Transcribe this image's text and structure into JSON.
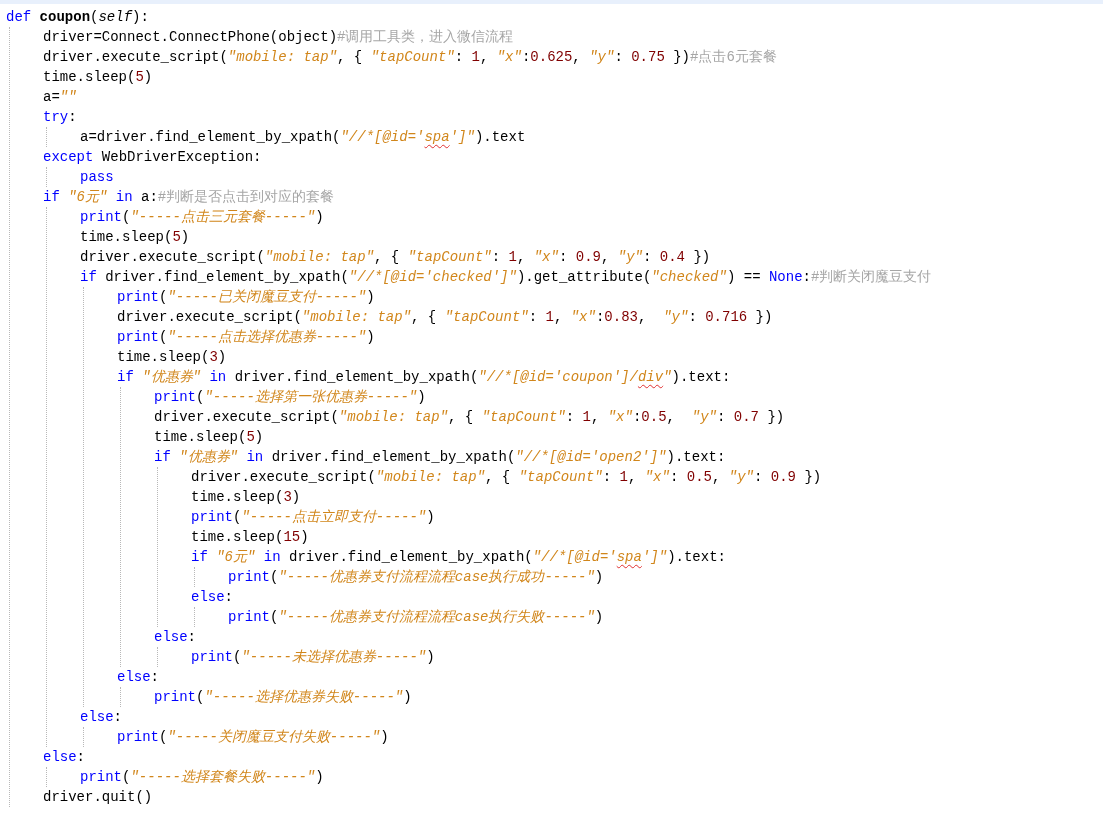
{
  "editor": {
    "lines": [
      {
        "tokens": [
          {
            "kind": "keyword",
            "text": "def"
          },
          {
            "kind": "name",
            "text": " coupon"
          },
          {
            "kind": "plain",
            "text": "("
          },
          {
            "kind": "param",
            "text": "self"
          },
          {
            "kind": "plain",
            "text": "):"
          }
        ],
        "children": [
          {
            "tokens": [
              {
                "kind": "plain",
                "text": "driver=Connect.ConnectPhone(object)"
              },
              {
                "kind": "comment",
                "text": "#调用工具类，进入微信流程"
              }
            ]
          },
          {
            "tokens": [
              {
                "kind": "plain",
                "text": "driver.execute_script("
              },
              {
                "kind": "string",
                "text": "\"mobile: tap\""
              },
              {
                "kind": "plain",
                "text": ", { "
              },
              {
                "kind": "string",
                "text": "\"tapCount\""
              },
              {
                "kind": "plain",
                "text": ": "
              },
              {
                "kind": "number",
                "text": "1"
              },
              {
                "kind": "plain",
                "text": ", "
              },
              {
                "kind": "string",
                "text": "\"x\""
              },
              {
                "kind": "plain",
                "text": ":"
              },
              {
                "kind": "number",
                "text": "0.625"
              },
              {
                "kind": "plain",
                "text": ", "
              },
              {
                "kind": "string",
                "text": "\"y\""
              },
              {
                "kind": "plain",
                "text": ": "
              },
              {
                "kind": "number",
                "text": "0.75"
              },
              {
                "kind": "plain",
                "text": " })"
              },
              {
                "kind": "comment",
                "text": "#点击6元套餐"
              }
            ]
          },
          {
            "tokens": [
              {
                "kind": "plain",
                "text": "time.sleep("
              },
              {
                "kind": "number",
                "text": "5"
              },
              {
                "kind": "plain",
                "text": ")"
              }
            ]
          },
          {
            "tokens": [
              {
                "kind": "plain",
                "text": "a="
              },
              {
                "kind": "string",
                "text": "\"\""
              }
            ]
          },
          {
            "tokens": [
              {
                "kind": "keyword",
                "text": "try"
              },
              {
                "kind": "plain",
                "text": ":"
              }
            ],
            "children": [
              {
                "tokens": [
                  {
                    "kind": "plain",
                    "text": "a=driver.find_element_by_xpath("
                  },
                  {
                    "kind": "string",
                    "text": "\"//*[@id='"
                  },
                  {
                    "kind": "flagged",
                    "text": "spa"
                  },
                  {
                    "kind": "string",
                    "text": "']\""
                  },
                  {
                    "kind": "plain",
                    "text": ").text"
                  }
                ]
              }
            ]
          },
          {
            "tokens": [
              {
                "kind": "keyword",
                "text": "except"
              },
              {
                "kind": "plain",
                "text": " WebDriverException:"
              }
            ],
            "children": [
              {
                "tokens": [
                  {
                    "kind": "keyword",
                    "text": "pass"
                  }
                ]
              }
            ]
          },
          {
            "tokens": [
              {
                "kind": "keyword",
                "text": "if"
              },
              {
                "kind": "string",
                "text": " \"6元\""
              },
              {
                "kind": "keyword",
                "text": " in"
              },
              {
                "kind": "plain",
                "text": " a:"
              },
              {
                "kind": "comment",
                "text": "#判断是否点击到对应的套餐"
              }
            ],
            "children": [
              {
                "tokens": [
                  {
                    "kind": "keyword",
                    "text": "print"
                  },
                  {
                    "kind": "plain",
                    "text": "("
                  },
                  {
                    "kind": "string",
                    "text": "\"-----点击三元套餐-----\""
                  },
                  {
                    "kind": "plain",
                    "text": ")"
                  }
                ]
              },
              {
                "tokens": [
                  {
                    "kind": "plain",
                    "text": "time.sleep("
                  },
                  {
                    "kind": "number",
                    "text": "5"
                  },
                  {
                    "kind": "plain",
                    "text": ")"
                  }
                ]
              },
              {
                "tokens": [
                  {
                    "kind": "plain",
                    "text": "driver.execute_script("
                  },
                  {
                    "kind": "string",
                    "text": "\"mobile: tap\""
                  },
                  {
                    "kind": "plain",
                    "text": ", { "
                  },
                  {
                    "kind": "string",
                    "text": "\"tapCount\""
                  },
                  {
                    "kind": "plain",
                    "text": ": "
                  },
                  {
                    "kind": "number",
                    "text": "1"
                  },
                  {
                    "kind": "plain",
                    "text": ", "
                  },
                  {
                    "kind": "string",
                    "text": "\"x\""
                  },
                  {
                    "kind": "plain",
                    "text": ": "
                  },
                  {
                    "kind": "number",
                    "text": "0.9"
                  },
                  {
                    "kind": "plain",
                    "text": ", "
                  },
                  {
                    "kind": "string",
                    "text": "\"y\""
                  },
                  {
                    "kind": "plain",
                    "text": ": "
                  },
                  {
                    "kind": "number",
                    "text": "0.4"
                  },
                  {
                    "kind": "plain",
                    "text": " })"
                  }
                ]
              },
              {
                "tokens": [
                  {
                    "kind": "keyword",
                    "text": "if"
                  },
                  {
                    "kind": "plain",
                    "text": " driver.find_element_by_xpath("
                  },
                  {
                    "kind": "string",
                    "text": "\"//*[@id='checked']\""
                  },
                  {
                    "kind": "plain",
                    "text": ").get_attribute("
                  },
                  {
                    "kind": "string",
                    "text": "\"checked\""
                  },
                  {
                    "kind": "plain",
                    "text": ") == "
                  },
                  {
                    "kind": "keyword",
                    "text": "None"
                  },
                  {
                    "kind": "plain",
                    "text": ":"
                  },
                  {
                    "kind": "comment",
                    "text": "#判断关闭魔豆支付"
                  }
                ],
                "children": [
                  {
                    "tokens": [
                      {
                        "kind": "keyword",
                        "text": "print"
                      },
                      {
                        "kind": "plain",
                        "text": "("
                      },
                      {
                        "kind": "string",
                        "text": "\"-----已关闭魔豆支付-----\""
                      },
                      {
                        "kind": "plain",
                        "text": ")"
                      }
                    ]
                  },
                  {
                    "tokens": [
                      {
                        "kind": "plain",
                        "text": "driver.execute_script("
                      },
                      {
                        "kind": "string",
                        "text": "\"mobile: tap\""
                      },
                      {
                        "kind": "plain",
                        "text": ", { "
                      },
                      {
                        "kind": "string",
                        "text": "\"tapCount\""
                      },
                      {
                        "kind": "plain",
                        "text": ": "
                      },
                      {
                        "kind": "number",
                        "text": "1"
                      },
                      {
                        "kind": "plain",
                        "text": ", "
                      },
                      {
                        "kind": "string",
                        "text": "\"x\""
                      },
                      {
                        "kind": "plain",
                        "text": ":"
                      },
                      {
                        "kind": "number",
                        "text": "0.83"
                      },
                      {
                        "kind": "plain",
                        "text": ",  "
                      },
                      {
                        "kind": "string",
                        "text": "\"y\""
                      },
                      {
                        "kind": "plain",
                        "text": ": "
                      },
                      {
                        "kind": "number",
                        "text": "0.716"
                      },
                      {
                        "kind": "plain",
                        "text": " })"
                      }
                    ]
                  },
                  {
                    "tokens": [
                      {
                        "kind": "keyword",
                        "text": "print"
                      },
                      {
                        "kind": "plain",
                        "text": "("
                      },
                      {
                        "kind": "string",
                        "text": "\"-----点击选择优惠券-----\""
                      },
                      {
                        "kind": "plain",
                        "text": ")"
                      }
                    ]
                  },
                  {
                    "tokens": [
                      {
                        "kind": "plain",
                        "text": "time.sleep("
                      },
                      {
                        "kind": "number",
                        "text": "3"
                      },
                      {
                        "kind": "plain",
                        "text": ")"
                      }
                    ]
                  },
                  {
                    "tokens": [
                      {
                        "kind": "keyword",
                        "text": "if"
                      },
                      {
                        "kind": "string",
                        "text": " \"优惠券\""
                      },
                      {
                        "kind": "keyword",
                        "text": " in"
                      },
                      {
                        "kind": "plain",
                        "text": " driver.find_element_by_xpath("
                      },
                      {
                        "kind": "string",
                        "text": "\"//*[@id='coupon']/"
                      },
                      {
                        "kind": "flagged",
                        "text": "div"
                      },
                      {
                        "kind": "string",
                        "text": "\""
                      },
                      {
                        "kind": "plain",
                        "text": ").text:"
                      }
                    ],
                    "children": [
                      {
                        "tokens": [
                          {
                            "kind": "keyword",
                            "text": "print"
                          },
                          {
                            "kind": "plain",
                            "text": "("
                          },
                          {
                            "kind": "string",
                            "text": "\"-----选择第一张优惠券-----\""
                          },
                          {
                            "kind": "plain",
                            "text": ")"
                          }
                        ]
                      },
                      {
                        "tokens": [
                          {
                            "kind": "plain",
                            "text": "driver.execute_script("
                          },
                          {
                            "kind": "string",
                            "text": "\"mobile: tap\""
                          },
                          {
                            "kind": "plain",
                            "text": ", { "
                          },
                          {
                            "kind": "string",
                            "text": "\"tapCount\""
                          },
                          {
                            "kind": "plain",
                            "text": ": "
                          },
                          {
                            "kind": "number",
                            "text": "1"
                          },
                          {
                            "kind": "plain",
                            "text": ", "
                          },
                          {
                            "kind": "string",
                            "text": "\"x\""
                          },
                          {
                            "kind": "plain",
                            "text": ":"
                          },
                          {
                            "kind": "number",
                            "text": "0.5"
                          },
                          {
                            "kind": "plain",
                            "text": ",  "
                          },
                          {
                            "kind": "string",
                            "text": "\"y\""
                          },
                          {
                            "kind": "plain",
                            "text": ": "
                          },
                          {
                            "kind": "number",
                            "text": "0.7"
                          },
                          {
                            "kind": "plain",
                            "text": " })"
                          }
                        ]
                      },
                      {
                        "tokens": [
                          {
                            "kind": "plain",
                            "text": "time.sleep("
                          },
                          {
                            "kind": "number",
                            "text": "5"
                          },
                          {
                            "kind": "plain",
                            "text": ")"
                          }
                        ]
                      },
                      {
                        "tokens": [
                          {
                            "kind": "keyword",
                            "text": "if"
                          },
                          {
                            "kind": "string",
                            "text": " \"优惠券\""
                          },
                          {
                            "kind": "keyword",
                            "text": " in"
                          },
                          {
                            "kind": "plain",
                            "text": " driver.find_element_by_xpath("
                          },
                          {
                            "kind": "string",
                            "text": "\"//*[@id='open2']\""
                          },
                          {
                            "kind": "plain",
                            "text": ").text:"
                          }
                        ],
                        "children": [
                          {
                            "tokens": [
                              {
                                "kind": "plain",
                                "text": "driver.execute_script("
                              },
                              {
                                "kind": "string",
                                "text": "\"mobile: tap\""
                              },
                              {
                                "kind": "plain",
                                "text": ", { "
                              },
                              {
                                "kind": "string",
                                "text": "\"tapCount\""
                              },
                              {
                                "kind": "plain",
                                "text": ": "
                              },
                              {
                                "kind": "number",
                                "text": "1"
                              },
                              {
                                "kind": "plain",
                                "text": ", "
                              },
                              {
                                "kind": "string",
                                "text": "\"x\""
                              },
                              {
                                "kind": "plain",
                                "text": ": "
                              },
                              {
                                "kind": "number",
                                "text": "0.5"
                              },
                              {
                                "kind": "plain",
                                "text": ", "
                              },
                              {
                                "kind": "string",
                                "text": "\"y\""
                              },
                              {
                                "kind": "plain",
                                "text": ": "
                              },
                              {
                                "kind": "number",
                                "text": "0.9"
                              },
                              {
                                "kind": "plain",
                                "text": " })"
                              }
                            ]
                          },
                          {
                            "tokens": [
                              {
                                "kind": "plain",
                                "text": "time.sleep("
                              },
                              {
                                "kind": "number",
                                "text": "3"
                              },
                              {
                                "kind": "plain",
                                "text": ")"
                              }
                            ]
                          },
                          {
                            "tokens": [
                              {
                                "kind": "keyword",
                                "text": "print"
                              },
                              {
                                "kind": "plain",
                                "text": "("
                              },
                              {
                                "kind": "string",
                                "text": "\"-----点击立即支付-----\""
                              },
                              {
                                "kind": "plain",
                                "text": ")"
                              }
                            ]
                          },
                          {
                            "tokens": [
                              {
                                "kind": "plain",
                                "text": "time.sleep("
                              },
                              {
                                "kind": "number",
                                "text": "15"
                              },
                              {
                                "kind": "plain",
                                "text": ")"
                              }
                            ]
                          },
                          {
                            "tokens": [
                              {
                                "kind": "keyword",
                                "text": "if"
                              },
                              {
                                "kind": "string",
                                "text": " \"6元\""
                              },
                              {
                                "kind": "keyword",
                                "text": " in"
                              },
                              {
                                "kind": "plain",
                                "text": " driver.find_element_by_xpath("
                              },
                              {
                                "kind": "string",
                                "text": "\"//*[@id='"
                              },
                              {
                                "kind": "flagged",
                                "text": "spa"
                              },
                              {
                                "kind": "string",
                                "text": "']\""
                              },
                              {
                                "kind": "plain",
                                "text": ").text:"
                              }
                            ],
                            "children": [
                              {
                                "tokens": [
                                  {
                                    "kind": "keyword",
                                    "text": "print"
                                  },
                                  {
                                    "kind": "plain",
                                    "text": "("
                                  },
                                  {
                                    "kind": "string",
                                    "text": "\"-----优惠券支付流程流程case执行成功-----\""
                                  },
                                  {
                                    "kind": "plain",
                                    "text": ")"
                                  }
                                ]
                              }
                            ]
                          },
                          {
                            "tokens": [
                              {
                                "kind": "keyword",
                                "text": "else"
                              },
                              {
                                "kind": "plain",
                                "text": ":"
                              }
                            ],
                            "children": [
                              {
                                "tokens": [
                                  {
                                    "kind": "keyword",
                                    "text": "print"
                                  },
                                  {
                                    "kind": "plain",
                                    "text": "("
                                  },
                                  {
                                    "kind": "string",
                                    "text": "\"-----优惠券支付流程流程case执行失败-----\""
                                  },
                                  {
                                    "kind": "plain",
                                    "text": ")"
                                  }
                                ]
                              }
                            ]
                          }
                        ]
                      },
                      {
                        "tokens": [
                          {
                            "kind": "keyword",
                            "text": "else"
                          },
                          {
                            "kind": "plain",
                            "text": ":"
                          }
                        ],
                        "children": [
                          {
                            "tokens": [
                              {
                                "kind": "keyword",
                                "text": "print"
                              },
                              {
                                "kind": "plain",
                                "text": "("
                              },
                              {
                                "kind": "string",
                                "text": "\"-----未选择优惠券-----\""
                              },
                              {
                                "kind": "plain",
                                "text": ")"
                              }
                            ]
                          }
                        ]
                      }
                    ]
                  },
                  {
                    "tokens": [
                      {
                        "kind": "keyword",
                        "text": "else"
                      },
                      {
                        "kind": "plain",
                        "text": ":"
                      }
                    ],
                    "children": [
                      {
                        "tokens": [
                          {
                            "kind": "keyword",
                            "text": "print"
                          },
                          {
                            "kind": "plain",
                            "text": "("
                          },
                          {
                            "kind": "string",
                            "text": "\"-----选择优惠券失败-----\""
                          },
                          {
                            "kind": "plain",
                            "text": ")"
                          }
                        ]
                      }
                    ]
                  }
                ]
              },
              {
                "tokens": [
                  {
                    "kind": "keyword",
                    "text": "else"
                  },
                  {
                    "kind": "plain",
                    "text": ":"
                  }
                ],
                "children": [
                  {
                    "tokens": [
                      {
                        "kind": "keyword",
                        "text": "print"
                      },
                      {
                        "kind": "plain",
                        "text": "("
                      },
                      {
                        "kind": "string",
                        "text": "\"-----关闭魔豆支付失败-----\""
                      },
                      {
                        "kind": "plain",
                        "text": ")"
                      }
                    ]
                  }
                ]
              }
            ]
          },
          {
            "tokens": [
              {
                "kind": "keyword",
                "text": "else"
              },
              {
                "kind": "plain",
                "text": ":"
              }
            ],
            "children": [
              {
                "tokens": [
                  {
                    "kind": "keyword",
                    "text": "print"
                  },
                  {
                    "kind": "plain",
                    "text": "("
                  },
                  {
                    "kind": "string",
                    "text": "\"-----选择套餐失败-----\""
                  },
                  {
                    "kind": "plain",
                    "text": ")"
                  }
                ]
              }
            ]
          },
          {
            "tokens": [
              {
                "kind": "plain",
                "text": "driver.quit()"
              }
            ]
          }
        ]
      }
    ]
  }
}
